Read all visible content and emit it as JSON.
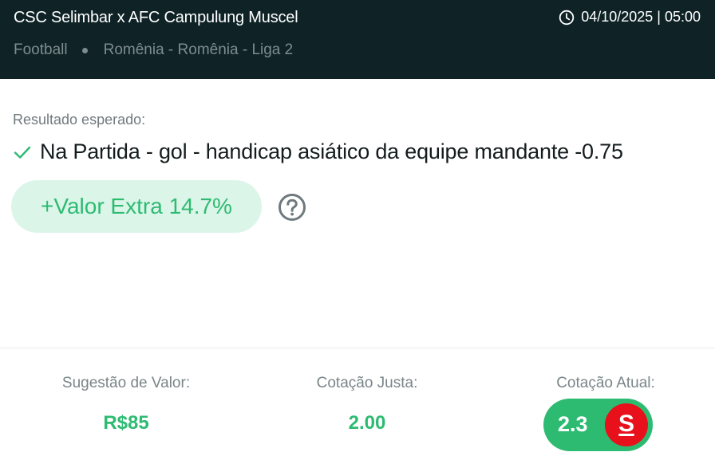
{
  "header": {
    "match_title": "CSC Selimbar x AFC Campulung Muscel",
    "datetime": "04/10/2025 | 05:00",
    "sport": "Football",
    "competition": "Romênia - Romênia - Liga 2"
  },
  "prediction": {
    "label": "Resultado esperado:",
    "text": "Na Partida - gol - handicap asiático da equipe mandante -0.75"
  },
  "value_badge": {
    "text": "+Valor Extra 14.7%"
  },
  "stats": {
    "suggestion_label": "Sugestão de Valor:",
    "suggestion_value": "R$85",
    "fair_odds_label": "Cotação Justa:",
    "fair_odds_value": "2.00",
    "current_odds_label": "Cotação Atual:",
    "current_odds_value": "2.3"
  },
  "bookmaker": {
    "logo_letter": "S",
    "color": "#e8101a"
  },
  "colors": {
    "header_bg": "#0f2327",
    "accent_green": "#2dbb72",
    "badge_bg": "#dcf5e9"
  },
  "icons": {
    "clock": "clock-icon",
    "check": "check-icon",
    "help": "question-circle-icon"
  }
}
